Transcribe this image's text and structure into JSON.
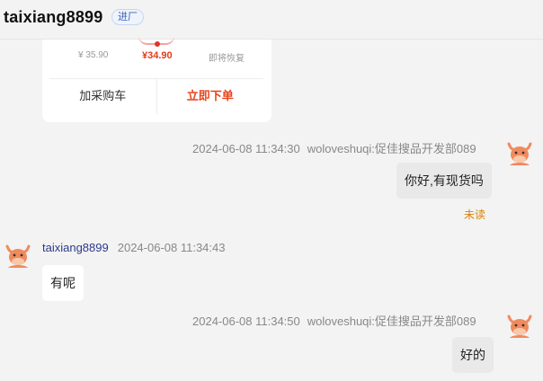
{
  "header": {
    "title": "taixiang8899",
    "badge": "进厂"
  },
  "product_card": {
    "prices": [
      "¥ 35.90",
      "¥34.90",
      "即将恢复"
    ],
    "actions": {
      "add_to_cart": "加采购车",
      "order_now": "立即下单"
    }
  },
  "messages": [
    {
      "direction": "out",
      "time": "2024-06-08 11:34:30",
      "sender": "woloveshuqi:促佳搜品开发部089",
      "text": "你好,有现货吗",
      "status": "未读"
    },
    {
      "direction": "in",
      "sender": "taixiang8899",
      "time": "2024-06-08 11:34:43",
      "text": "有呢"
    },
    {
      "direction": "out",
      "time": "2024-06-08 11:34:50",
      "sender": "woloveshuqi:促佳搜品开发部089",
      "text": "好的"
    }
  ],
  "colors": {
    "accent_red": "#e8441a",
    "unread": "#d98200",
    "avatar": "#f08a5d"
  }
}
